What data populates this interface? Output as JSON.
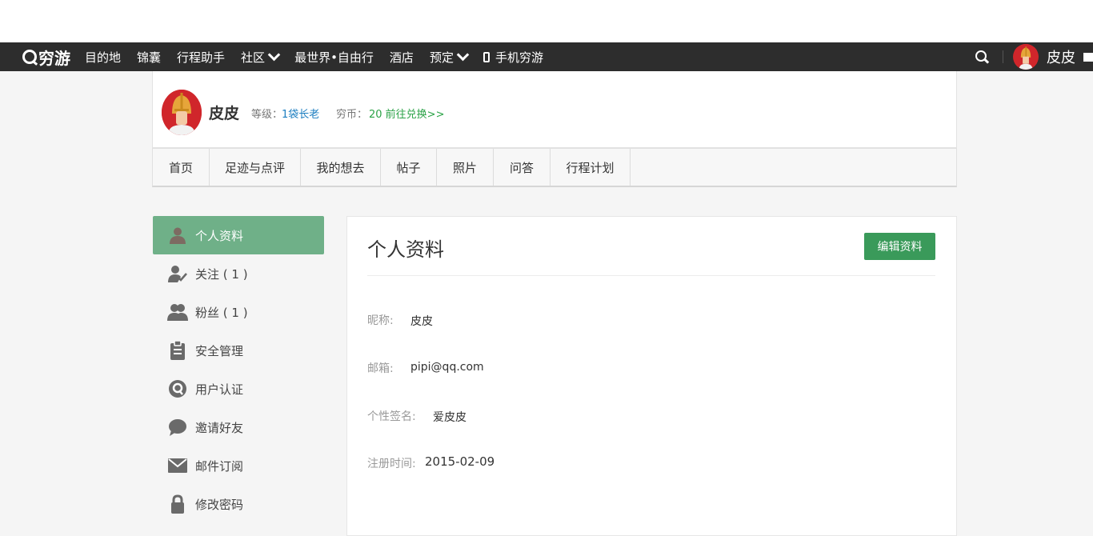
{
  "nav": {
    "logo": "穷游",
    "items": [
      "目的地",
      "锦囊",
      "行程助手",
      "社区",
      "最世界•自由行",
      "酒店",
      "预定",
      "手机穷游"
    ],
    "user_name": "皮皮"
  },
  "profile": {
    "name": "皮皮",
    "level_label": "等级：",
    "level_value": "1袋长老",
    "coin_label": "穷币：",
    "coin_value": "20 前往兑换>>"
  },
  "tabs": [
    "首页",
    "足迹与点评",
    "我的想去",
    "帖子",
    "照片",
    "问答",
    "行程计划"
  ],
  "sidebar": {
    "items": [
      {
        "label": "个人资料",
        "icon": "user-icon"
      },
      {
        "label": "关注 ( 1 )",
        "icon": "user-check-icon"
      },
      {
        "label": "粉丝 ( 1 )",
        "icon": "users-icon"
      },
      {
        "label": "安全管理",
        "icon": "clipboard-icon"
      },
      {
        "label": "用户认证",
        "icon": "q-badge-icon"
      },
      {
        "label": "邀请好友",
        "icon": "chat-bubble-icon"
      },
      {
        "label": "邮件订阅",
        "icon": "envelope-icon"
      },
      {
        "label": "修改密码",
        "icon": "lock-icon"
      }
    ]
  },
  "content": {
    "title": "个人资料",
    "edit_button": "编辑资料",
    "fields": [
      {
        "label": "昵称:",
        "value": "皮皮"
      },
      {
        "label": "邮箱:",
        "value": "pipi@qq.com"
      },
      {
        "label": "个性签名:",
        "value": "爱皮皮"
      },
      {
        "label": "注册时间:",
        "value": "2015-02-09"
      }
    ]
  },
  "colors": {
    "navbar": "#2d2d2d",
    "active_sidebar": "#6fb088",
    "edit_button": "#3a9a5a",
    "level_link": "#1b7dc0",
    "coin_link": "#2aa246"
  }
}
